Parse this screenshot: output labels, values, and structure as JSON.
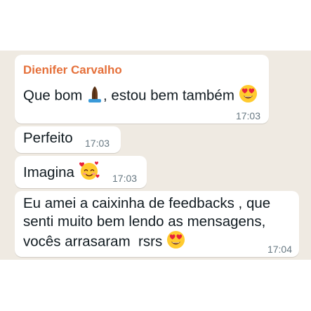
{
  "messages": [
    {
      "sender": "Dienifer Carvalho",
      "text_before_icon": "Que bom ",
      "icon": "folded-hands-icon",
      "text_after_icon": ", estou bem também ",
      "icon_end": "heart-eyes-face-icon",
      "time": "17:03"
    },
    {
      "text": "Perfeito",
      "time": "17:03"
    },
    {
      "text": "Imagina ",
      "icon": "smiling-face-with-hearts-icon",
      "time": "17:03"
    },
    {
      "line1": "Eu amei a caixinha de feedbacks , que",
      "line2": "senti muito bem lendo as mensagens,",
      "line3": "vocês arrasaram  rsrs ",
      "icon": "heart-eyes-face-icon",
      "time": "17:04"
    }
  ],
  "colors": {
    "chat_background": "#efeae2",
    "bubble": "#ffffff",
    "sender_name": "#e5703a",
    "text": "#111b21",
    "timestamp": "#667781"
  }
}
